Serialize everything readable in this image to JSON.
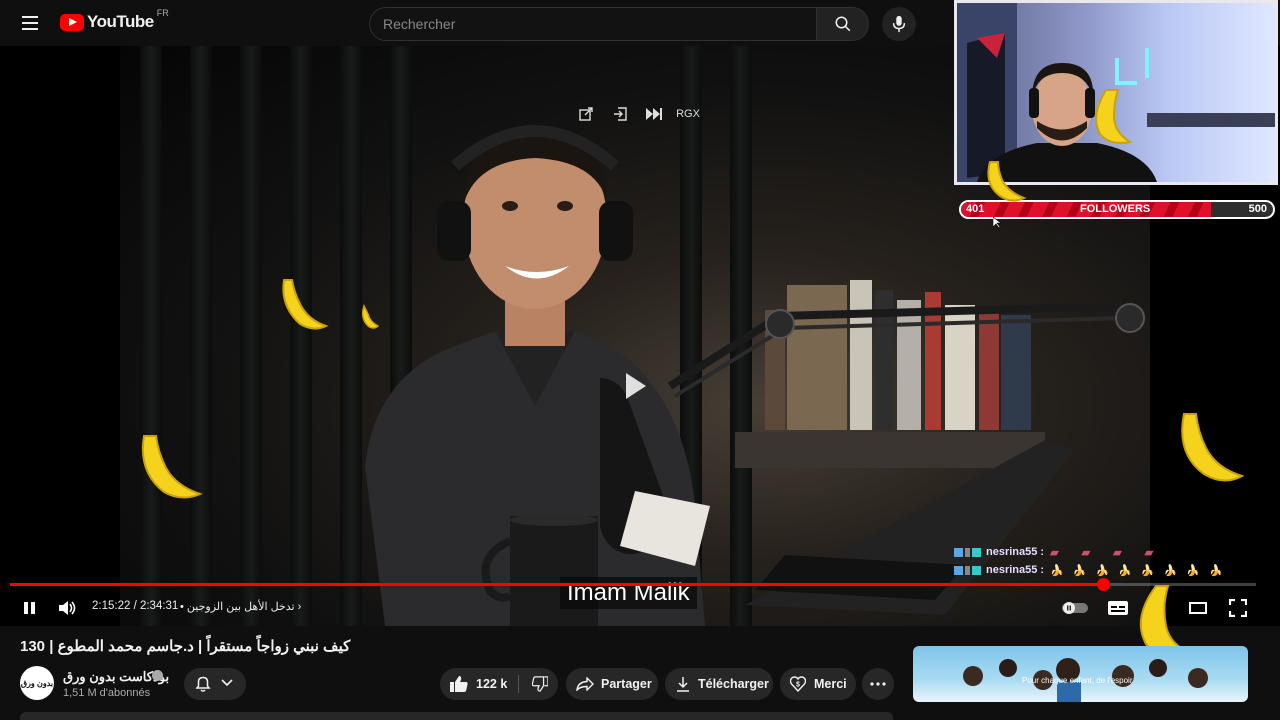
{
  "header": {
    "logo_text": "YouTube",
    "country_code": "FR",
    "search_placeholder": "Rechercher"
  },
  "player": {
    "overlay_tool_label": "RGX",
    "subtitle": "Imam Malik",
    "time_display": "2:15:22 / 2:34:31",
    "chapter_label": "• تدخل الأهل بين الزوجين",
    "progress_fraction": 0.877,
    "colors": {
      "progress": "#ff0000"
    }
  },
  "stream_overlay": {
    "followers_current": "401",
    "followers_label": "FOLLOWERS",
    "followers_goal": "500",
    "followers_fraction": 0.802,
    "chat": [
      {
        "user": "nesrina55 :",
        "message": "▰ ▰ ▰ ▰",
        "emote": "pink-face-emote"
      },
      {
        "user": "nesrina55 :",
        "message": "🍌🍌🍌🍌🍌🍌🍌🍌",
        "emote": "banana-emote"
      }
    ]
  },
  "video": {
    "title": "130 | كيف نبني زواجاً مستقراً | د.جاسم محمد المطوع",
    "channel_name": "بودكاست بدون ورق",
    "channel_avatar_text": "بدون ورق",
    "subscribers": "1,51 M d'abonnés",
    "like_count": "122 k",
    "share_label": "Partager",
    "download_label": "Télécharger",
    "thanks_label": "Merci"
  },
  "ad": {
    "text": "Pour chaque enfant, de l'espoir"
  }
}
